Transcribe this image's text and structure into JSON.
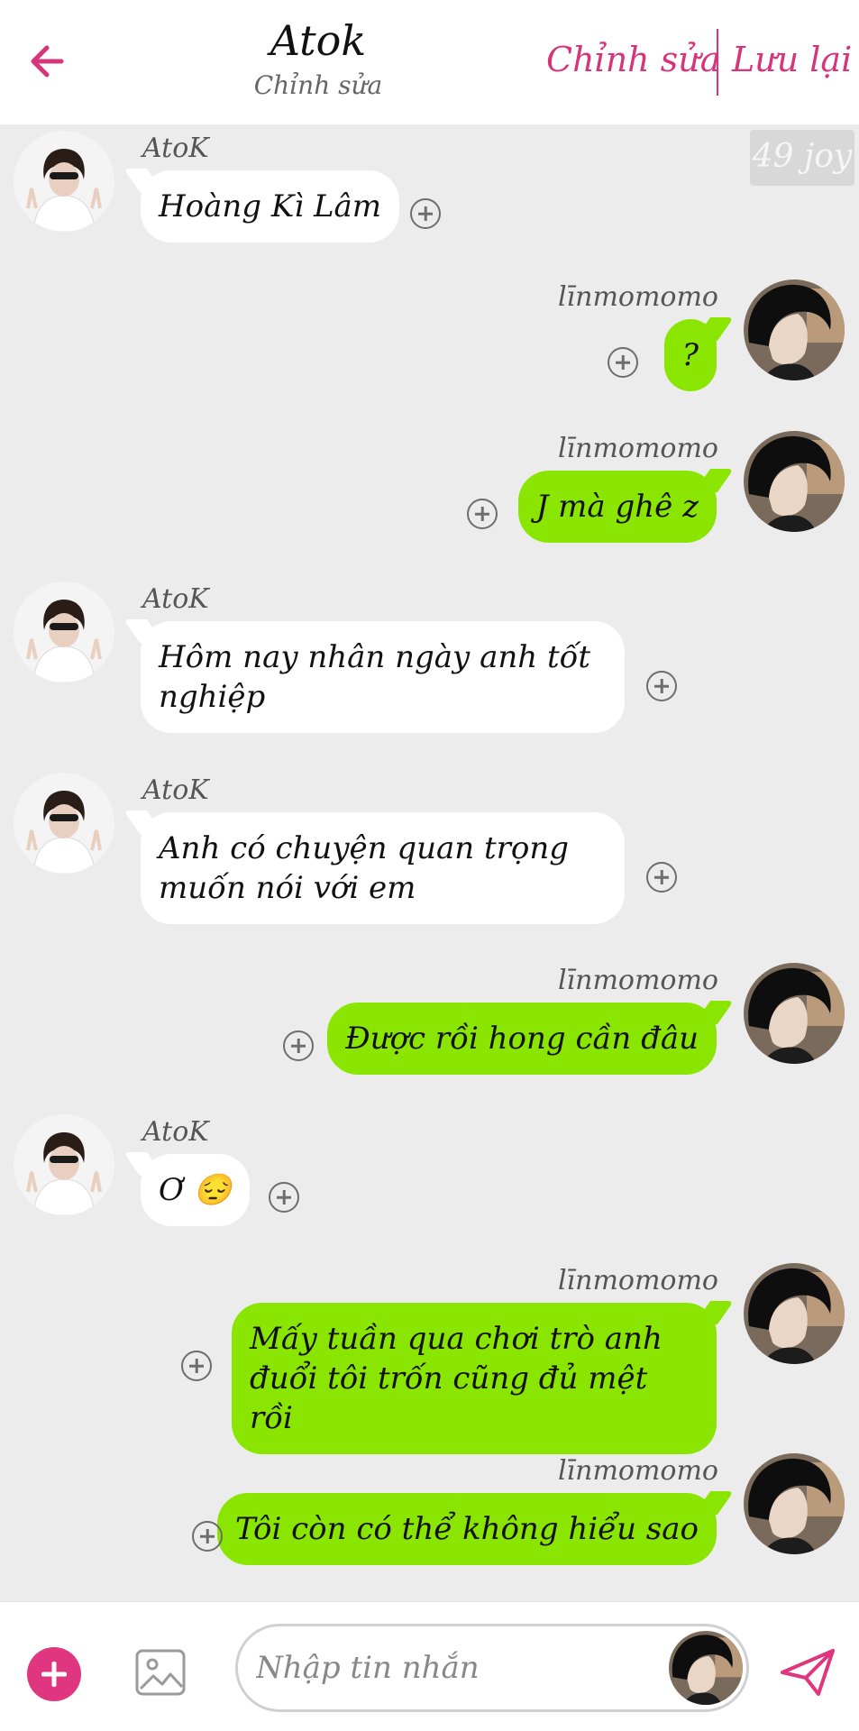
{
  "header": {
    "title": "Atok",
    "subtitle": "Chỉnh sửa",
    "edit_label": "Chỉnh sửa",
    "save_label": "Lưu lại"
  },
  "badge": "49 joy",
  "colors": {
    "accent": "#d6357c",
    "outgoing_bubble": "#8ae500",
    "incoming_bubble": "#ffffff",
    "chat_background": "#ececec"
  },
  "messages": [
    {
      "name": "AtoK",
      "text": "Hoàng Kì Lâm",
      "direction": "in"
    },
    {
      "name": "līnmomomo",
      "text": "?",
      "direction": "out"
    },
    {
      "name": "līnmomomo",
      "text": "J mà ghê z",
      "direction": "out"
    },
    {
      "name": "AtoK",
      "text": "Hôm nay nhân ngày anh tốt nghiệp",
      "direction": "in"
    },
    {
      "name": "AtoK",
      "text": "Anh có chuyện quan trọng muốn nói với em",
      "direction": "in"
    },
    {
      "name": "līnmomomo",
      "text": "Được rồi hong cần đâu",
      "direction": "out"
    },
    {
      "name": "AtoK",
      "text": "Ơ 😔",
      "direction": "in"
    },
    {
      "name": "līnmomomo",
      "text": "Mấy tuần qua chơi trò anh đuổi tôi trốn cũng đủ mệt rồi",
      "direction": "out"
    },
    {
      "name": "līnmomomo",
      "text": "Tôi còn có thể không hiểu sao",
      "direction": "out"
    }
  ],
  "composer": {
    "placeholder": "Nhập tin nhắn",
    "value": ""
  },
  "icons": {
    "back": "arrow-left-icon",
    "add": "plus-icon",
    "image": "image-icon",
    "send": "send-icon",
    "message_add": "plus-circle-icon"
  }
}
